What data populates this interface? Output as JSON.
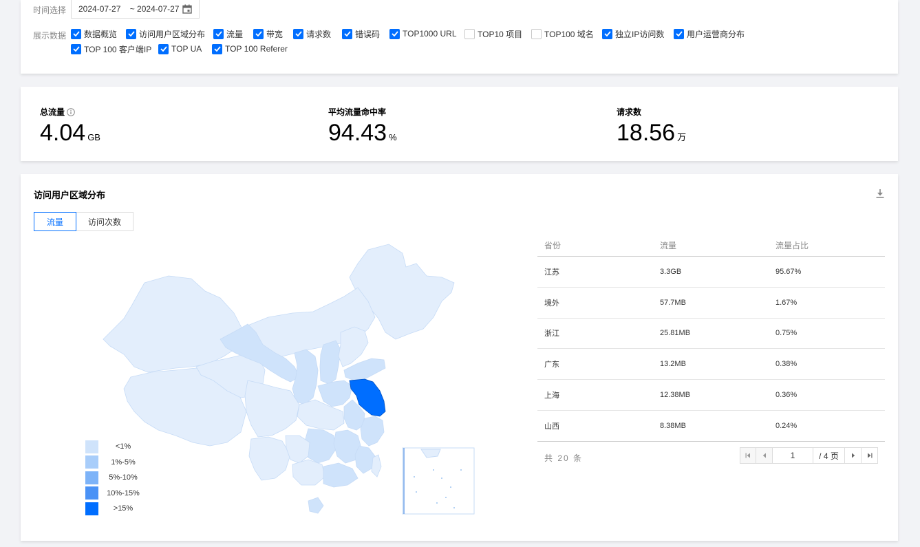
{
  "filter": {
    "time_label": "时间选择",
    "date_range": "2024-07-27    ~ 2024-07-27",
    "display_label": "展示数据",
    "options_row1": [
      {
        "label": "数据概览",
        "checked": true
      },
      {
        "label": "访问用户区域分布",
        "checked": true
      },
      {
        "label": "流量",
        "checked": true
      },
      {
        "label": "带宽",
        "checked": true
      },
      {
        "label": "请求数",
        "checked": true
      },
      {
        "label": "错误码",
        "checked": true
      },
      {
        "label": "TOP1000 URL",
        "checked": true
      },
      {
        "label": "TOP10 项目",
        "checked": false
      },
      {
        "label": "TOP100 域名",
        "checked": false
      },
      {
        "label": "独立IP访问数",
        "checked": true
      },
      {
        "label": "用户运营商分布",
        "checked": true
      }
    ],
    "options_row2": [
      {
        "label": "TOP 100 客户端IP",
        "checked": true
      },
      {
        "label": "TOP UA",
        "checked": true
      },
      {
        "label": "TOP 100 Referer",
        "checked": true
      }
    ]
  },
  "stats": [
    {
      "label": "总流量",
      "value": "4.04",
      "unit": "GB"
    },
    {
      "label": "平均流量命中率",
      "value": "94.43",
      "unit": "%"
    },
    {
      "label": "请求数",
      "value": "18.56",
      "unit": "万"
    }
  ],
  "region": {
    "title": "访问用户区域分布",
    "tabs": [
      {
        "label": "流量",
        "active": true
      },
      {
        "label": "访问次数",
        "active": false
      }
    ],
    "legend": [
      {
        "label": "<1%",
        "color": "#cfe3fb"
      },
      {
        "label": "1%-5%",
        "color": "#a8cdfa"
      },
      {
        "label": "5%-10%",
        "color": "#7db3f8"
      },
      {
        "label": "10%-15%",
        "color": "#4a92f6"
      },
      {
        "label": ">15%",
        "color": "#006eff"
      }
    ],
    "table": {
      "headers": [
        "省份",
        "流量",
        "流量占比"
      ],
      "rows": [
        [
          "江苏",
          "3.3GB",
          "95.67%"
        ],
        [
          "境外",
          "57.7MB",
          "1.67%"
        ],
        [
          "浙江",
          "25.81MB",
          "0.75%"
        ],
        [
          "广东",
          "13.2MB",
          "0.38%"
        ],
        [
          "上海",
          "12.38MB",
          "0.36%"
        ],
        [
          "山西",
          "8.38MB",
          "0.24%"
        ]
      ]
    },
    "total_text": "共 20 条",
    "pager": {
      "current": "1",
      "total_text": "/ 4 页"
    }
  },
  "colors": {
    "accent": "#006eff",
    "map_base": "#e3eefc",
    "map_light": "#cfe3fb",
    "map_border": "#ffffff"
  }
}
